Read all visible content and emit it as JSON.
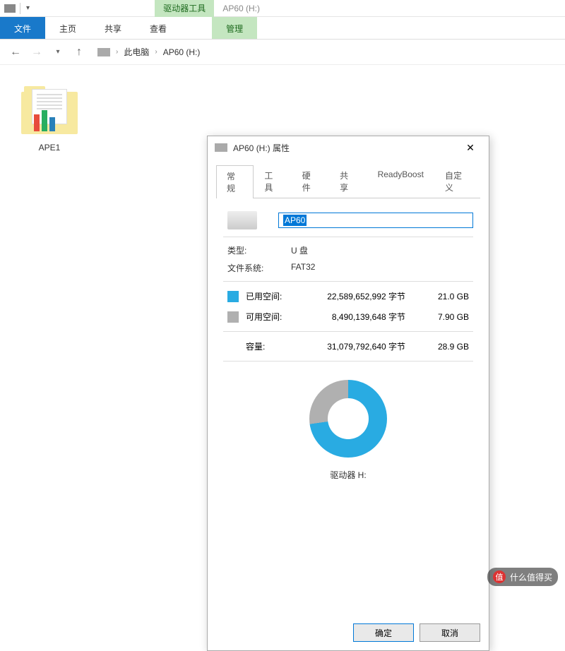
{
  "titlebar": {
    "context_group": "驱动器工具",
    "context_label": "AP60 (H:)"
  },
  "ribbon": {
    "file": "文件",
    "home": "主页",
    "share": "共享",
    "view": "查看",
    "manage": "管理"
  },
  "nav": {
    "this_pc": "此电脑",
    "location": "AP60 (H:)"
  },
  "folder": {
    "name": "APE1"
  },
  "dialog": {
    "title": "AP60 (H:) 属性",
    "tabs": {
      "general": "常规",
      "tools": "工具",
      "hardware": "硬件",
      "sharing": "共享",
      "readyboost": "ReadyBoost",
      "customize": "自定义"
    },
    "drive_name": "AP60",
    "type_label": "类型:",
    "type_value": "U 盘",
    "fs_label": "文件系统:",
    "fs_value": "FAT32",
    "used_label": "已用空间:",
    "used_bytes": "22,589,652,992 字节",
    "used_gb": "21.0 GB",
    "free_label": "可用空间:",
    "free_bytes": "8,490,139,648 字节",
    "free_gb": "7.90 GB",
    "capacity_label": "容量:",
    "capacity_bytes": "31,079,792,640 字节",
    "capacity_gb": "28.9 GB",
    "drive_label": "驱动器 H:",
    "ok": "确定",
    "cancel": "取消"
  },
  "watermark": "什么值得买",
  "chart_data": {
    "type": "pie",
    "title": "驱动器 H:",
    "series": [
      {
        "name": "已用空间",
        "value": 21.0,
        "color": "#29abe2"
      },
      {
        "name": "可用空间",
        "value": 7.9,
        "color": "#b0b0b0"
      }
    ],
    "unit": "GB",
    "total": 28.9
  }
}
